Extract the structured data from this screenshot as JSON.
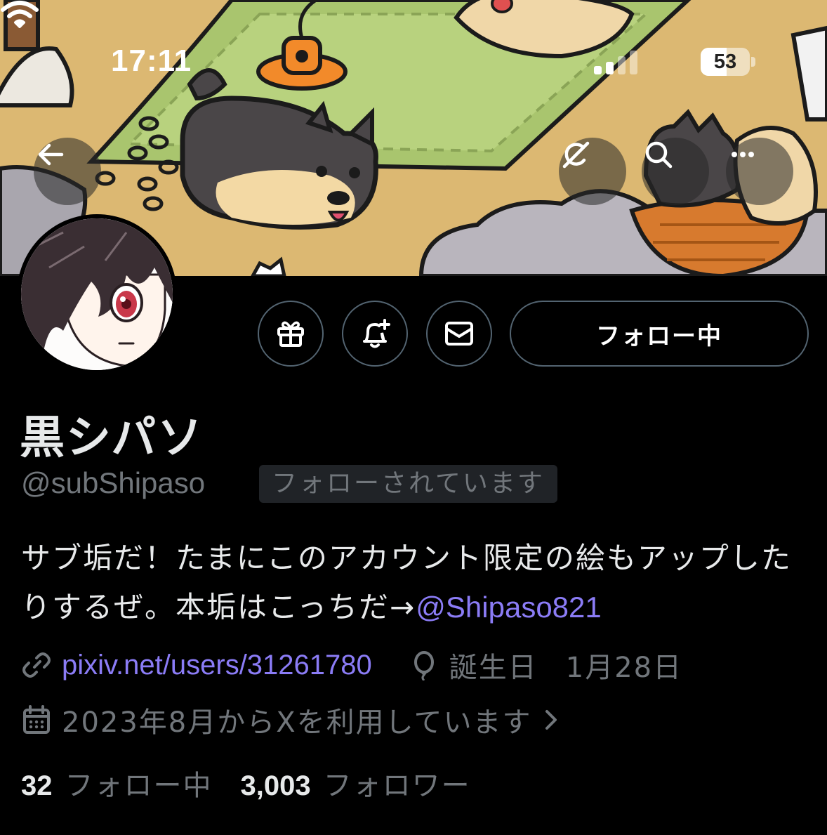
{
  "status_bar": {
    "time": "17:11",
    "battery_percent": "53",
    "battery_level": 0.53
  },
  "banner_buttons": {
    "back": "arrow-left-icon",
    "grok": "grok-icon",
    "search": "search-icon",
    "more": "more-icon"
  },
  "actions": {
    "follow_label": "フォロー中"
  },
  "profile": {
    "display_name": "黒シパソ",
    "handle": "@subShipaso",
    "follows_you": "フォローされています",
    "bio_text": "サブ垢だ！たまにこのアカウント限定の絵もアップしたりするぜ。本垢はこっちだ→",
    "bio_mention": "@Shipaso821",
    "link": "pixiv.net/users/31261780",
    "birthday_label": "誕生日",
    "birthday_date": "1月28日",
    "joined": "2023年8月からXを利用しています"
  },
  "stats": {
    "following_count": "32",
    "following_label": "フォロー中",
    "followers_count": "3,003",
    "followers_label": "フォロワー"
  },
  "colors": {
    "accent": "#8b7cf6",
    "secondary_text": "#71767b",
    "border": "#536471"
  }
}
